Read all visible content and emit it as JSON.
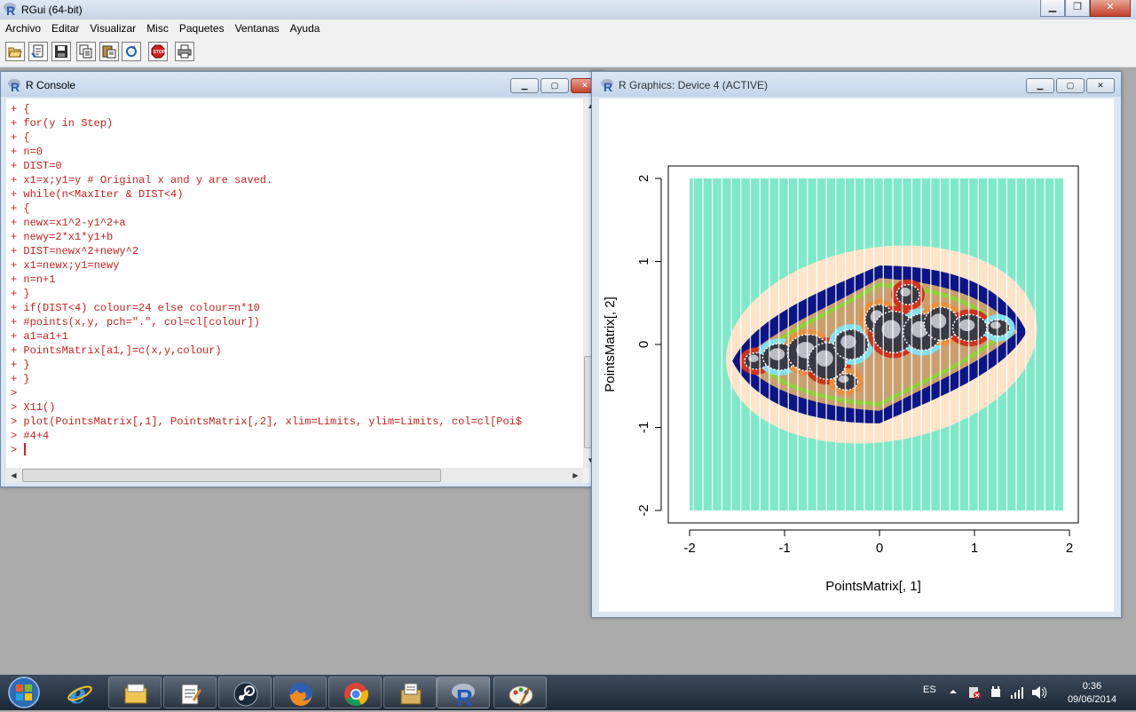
{
  "app": {
    "title": "RGui (64-bit)"
  },
  "menu": [
    "Archivo",
    "Editar",
    "Visualizar",
    "Misc",
    "Paquetes",
    "Ventanas",
    "Ayuda"
  ],
  "toolbar": [
    "open-script-icon",
    "load-workspace-icon",
    "save-icon",
    "copy-icon",
    "paste-icon",
    "refresh-icon",
    "stop-icon",
    "print-icon"
  ],
  "console": {
    "title": "R Console",
    "lines": [
      "+ {",
      "+ for(y in Step)",
      "+ {",
      "+ n=0",
      "+ DIST=0",
      "+ x1=x;y1=y # Original x and y are saved.",
      "+ while(n<MaxIter & DIST<4)",
      "+ {",
      "+ newx=x1^2-y1^2+a",
      "+ newy=2*x1*y1+b",
      "+ DIST=newx^2+newy^2",
      "+ x1=newx;y1=newy",
      "+ n=n+1",
      "+ }",
      "+ if(DIST<4) colour=24 else colour=n*10",
      "+ #points(x,y, pch=\".\", col=cl[colour])",
      "+ a1=a1+1",
      "+ PointsMatrix[a1,]=c(x,y,colour)",
      "+ }",
      "+ }",
      ">",
      "> X11()",
      "> plot(PointsMatrix[,1], PointsMatrix[,2], xlim=Limits, ylim=Limits, col=cl[Poi$",
      "> #4+4",
      "> "
    ]
  },
  "graphics": {
    "title": "R Graphics: Device 4 (ACTIVE)"
  },
  "chart_data": {
    "type": "scatter",
    "title": "",
    "xlabel": "PointsMatrix[, 1]",
    "ylabel": "PointsMatrix[, 2]",
    "xlim": [
      -2,
      2
    ],
    "ylim": [
      -2,
      2
    ],
    "x_ticks": [
      -2,
      -1,
      0,
      1,
      2
    ],
    "y_ticks": [
      -2,
      -1,
      0,
      1,
      2
    ],
    "x_tick_labels": [
      "-2",
      "-1",
      "0",
      "1",
      "2"
    ],
    "y_tick_labels": [
      "-2",
      "-1",
      "0",
      "1",
      "2"
    ],
    "grid": false,
    "colors": {
      "background": "#7ee9c8",
      "outer_ring": "#fde3c8",
      "navy_ring": "#0c1585",
      "inner_band": "#c8a070",
      "green_band": "#8fcf38",
      "cyan": "#7fe0f0",
      "red": "#d0321c"
    }
  },
  "taskbar": {
    "language": "ES",
    "time": "0:36",
    "date": "09/06/2014",
    "apps": [
      "ie-icon",
      "explorer-icon",
      "notes-icon",
      "steam-icon",
      "firefox-icon",
      "chrome-icon",
      "files-icon",
      "r-icon",
      "paint-icon"
    ]
  }
}
